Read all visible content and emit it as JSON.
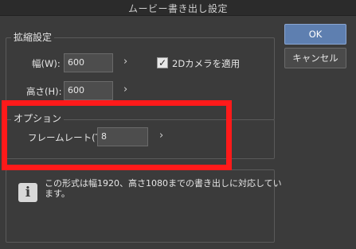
{
  "window": {
    "title": "ムービー書き出し設定"
  },
  "scaling": {
    "group_label": "拡縮設定",
    "width_label": "幅(W):",
    "width_value": "600",
    "height_label": "高さ(H):",
    "height_value": "600",
    "apply_2d_camera_label": "2Dカメラを適用",
    "apply_2d_camera_checked": true
  },
  "options": {
    "group_label": "オプション",
    "frame_rate_label": "フレームレート(T):",
    "frame_rate_value": "8"
  },
  "buttons": {
    "ok": "OK",
    "cancel": "キャンセル"
  },
  "info": {
    "icon": "info-icon",
    "message": "この形式は幅1920、高さ1080までの書き出しに対応しています。"
  },
  "colors": {
    "background": "#3b3b3b",
    "ok_button": "#5e7fb0",
    "highlight": "#ff1a1a"
  }
}
